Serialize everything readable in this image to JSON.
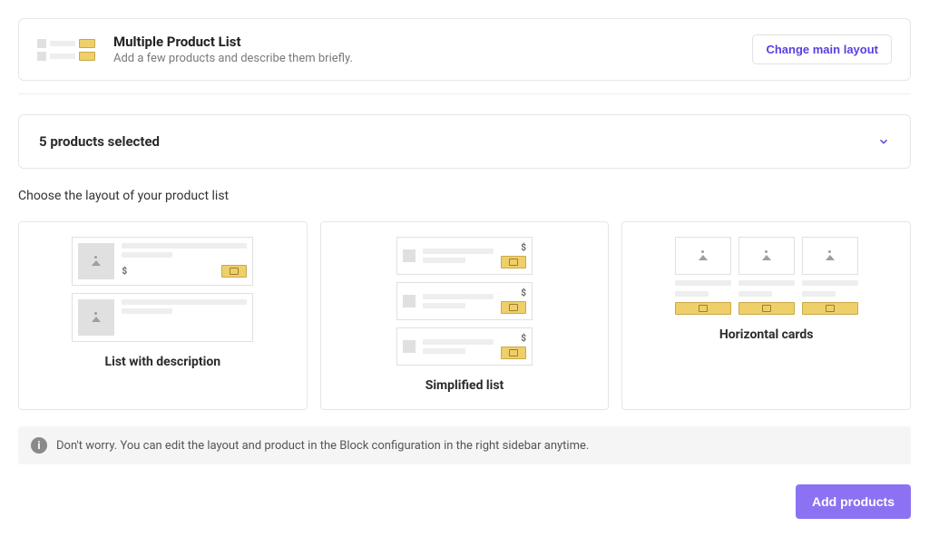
{
  "header": {
    "title": "Multiple Product List",
    "subtitle": "Add a few products and describe them briefly.",
    "change_layout_label": "Change main layout"
  },
  "accordion": {
    "title": "5 products selected"
  },
  "section_label": "Choose the layout of your product list",
  "choices": [
    {
      "id": "list-desc",
      "label": "List with description"
    },
    {
      "id": "simplified",
      "label": "Simplified list"
    },
    {
      "id": "hcards",
      "label": "Horizontal cards"
    }
  ],
  "note": {
    "text": "Don't worry. You can edit the layout and product in the Block configuration in the right sidebar anytime."
  },
  "footer": {
    "add_products_label": "Add products"
  }
}
